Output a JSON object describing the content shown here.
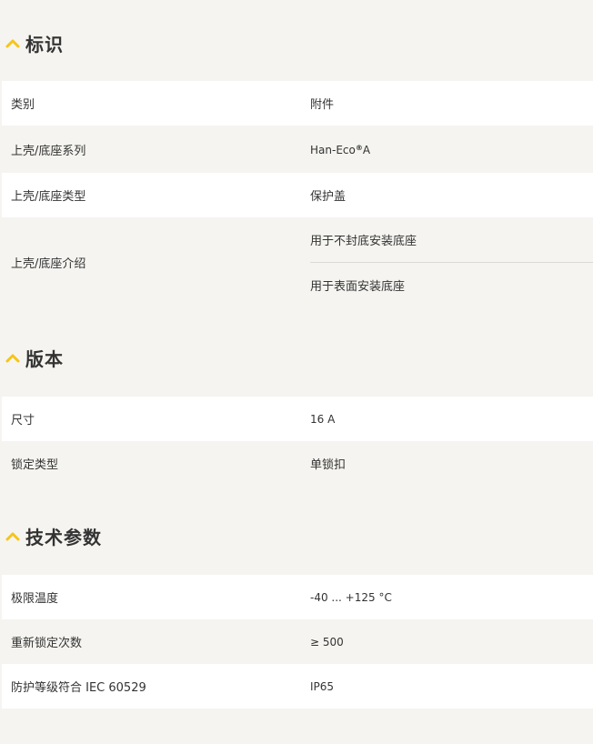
{
  "sections": [
    {
      "title": "标识",
      "rows": [
        {
          "label": "类别",
          "value": "附件"
        },
        {
          "label": "上壳/底座系列",
          "value_main": "Han-Eco",
          "value_sup": "®",
          "value_tail": " A"
        },
        {
          "label": "上壳/底座类型",
          "value": "保护盖"
        },
        {
          "label": "上壳/底座介绍",
          "values": [
            "用于不封底安装底座",
            "用于表面安装底座"
          ]
        }
      ]
    },
    {
      "title": "版本",
      "rows": [
        {
          "label": "尺寸",
          "value": "16 A"
        },
        {
          "label": "锁定类型",
          "value": "单锁扣"
        }
      ]
    },
    {
      "title": "技术参数",
      "rows": [
        {
          "label": "极限温度",
          "value": "-40 ... +125 °C"
        },
        {
          "label": "重新锁定次数",
          "value": "≥ 500"
        },
        {
          "label": "防护等级符合 IEC 60529",
          "value": "IP65"
        }
      ]
    }
  ],
  "colors": {
    "accent": "#f5c518",
    "background": "#f5f4f0",
    "row_white": "#ffffff",
    "text": "#333333"
  },
  "icons": {
    "section_toggle": "chevron-up-icon"
  }
}
